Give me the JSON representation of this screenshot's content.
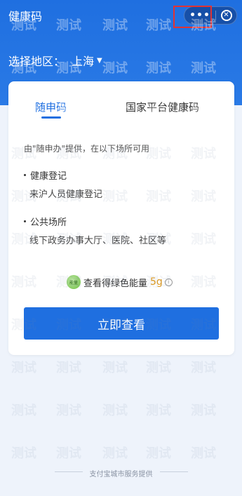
{
  "app": {
    "title": "健康码"
  },
  "capsule": {
    "more_label": "•••",
    "close_label": "✕"
  },
  "region": {
    "label": "选择地区：",
    "value": "上海",
    "caret": "▼"
  },
  "tabs": [
    {
      "label": "随申码",
      "active": true
    },
    {
      "label": "国家平台健康码",
      "active": false
    }
  ],
  "card": {
    "provider_text": "由\"随申办\"提供，在以下场所可用",
    "sections": [
      {
        "title": "健康登记",
        "subtitle": "来沪人员健康登记"
      },
      {
        "title": "公共场所",
        "subtitle": "线下政务办事大厅、医院、社区等"
      }
    ],
    "energy": {
      "icon_text": "能量",
      "text": "查看得绿色能量",
      "amount": "5g",
      "info_icon": "i"
    },
    "primary_button": "立即查看"
  },
  "footer": {
    "text": "支付宝城市服务提供"
  },
  "watermark": {
    "text": "测试"
  },
  "colors": {
    "brand_blue": "#1f6fe0",
    "energy_orange": "#e29a1a",
    "highlight_red": "#e23333"
  },
  "icons": [
    "more-dots-icon",
    "close-circle-icon",
    "caret-down-icon",
    "green-energy-icon",
    "info-icon"
  ]
}
